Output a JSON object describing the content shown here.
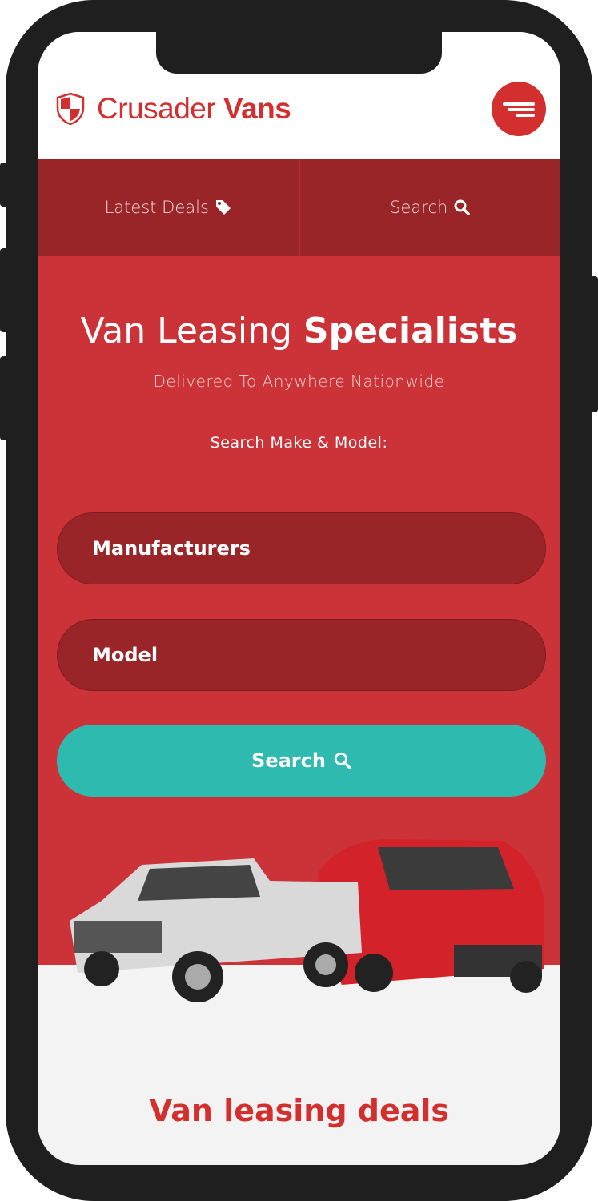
{
  "header": {
    "brand_regular": "Crusader",
    "brand_bold": "Vans",
    "logo_icon": "shield-icon",
    "menu_icon": "menu-icon"
  },
  "nav": {
    "items": [
      {
        "label": "Latest Deals",
        "icon": "tag-icon"
      },
      {
        "label": "Search",
        "icon": "search-icon"
      }
    ]
  },
  "hero": {
    "title_regular": "Van Leasing",
    "title_bold": "Specialists",
    "subtitle": "Delivered To Anywhere Nationwide",
    "search_label": "Search Make & Model:",
    "manufacturer_select": "Manufacturers",
    "model_select": "Model",
    "search_button": "Search"
  },
  "deals": {
    "title": "Van leasing deals"
  },
  "colors": {
    "brand_red": "#d32f2f",
    "hero_red": "#cc3338",
    "dark_red": "#9a2529",
    "teal": "#2fbaaf"
  }
}
